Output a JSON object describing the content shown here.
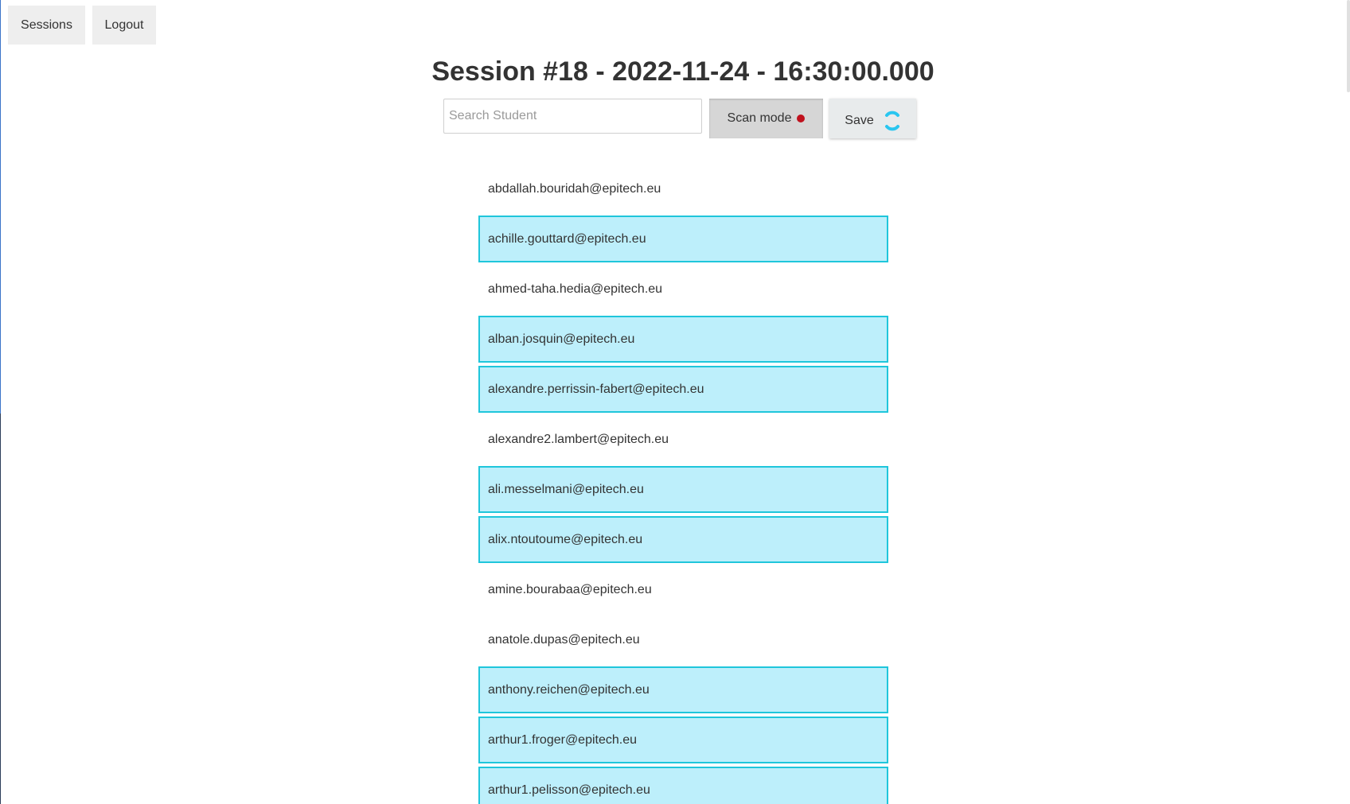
{
  "nav": {
    "sessions_label": "Sessions",
    "logout_label": "Logout"
  },
  "page": {
    "title": "Session #18 - 2022-11-24 - 16:30:00.000"
  },
  "toolbar": {
    "search_placeholder": "Search Student",
    "search_value": "",
    "scan_label": "Scan mode",
    "scan_indicator_color": "#c0111d",
    "save_label": "Save",
    "save_spinner_color": "#29c6f0"
  },
  "colors": {
    "present_fill": "#bdeffb",
    "present_border": "#1fc6db"
  },
  "students": [
    {
      "email": "abdallah.bouridah@epitech.eu",
      "present": false
    },
    {
      "email": "achille.gouttard@epitech.eu",
      "present": true
    },
    {
      "email": "ahmed-taha.hedia@epitech.eu",
      "present": false
    },
    {
      "email": "alban.josquin@epitech.eu",
      "present": true
    },
    {
      "email": "alexandre.perrissin-fabert@epitech.eu",
      "present": true
    },
    {
      "email": "alexandre2.lambert@epitech.eu",
      "present": false
    },
    {
      "email": "ali.messelmani@epitech.eu",
      "present": true
    },
    {
      "email": "alix.ntoutoume@epitech.eu",
      "present": true
    },
    {
      "email": "amine.bourabaa@epitech.eu",
      "present": false
    },
    {
      "email": "anatole.dupas@epitech.eu",
      "present": false
    },
    {
      "email": "anthony.reichen@epitech.eu",
      "present": true
    },
    {
      "email": "arthur1.froger@epitech.eu",
      "present": true
    },
    {
      "email": "arthur1.pelisson@epitech.eu",
      "present": true
    }
  ]
}
